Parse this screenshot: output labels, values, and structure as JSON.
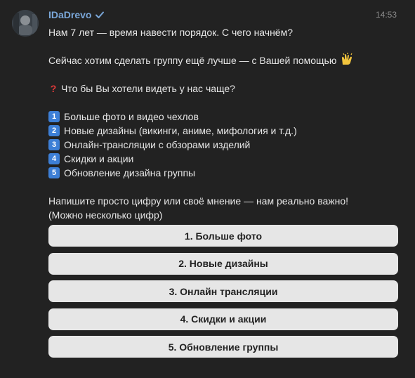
{
  "message": {
    "author": "IDaDrevo",
    "time": "14:53",
    "lines": {
      "l1": "Нам 7 лет — время навести порядок. С чего начнём?",
      "l2": "Сейчас хотим сделать группу ещё лучше — с Вашей помощью",
      "l3": "Что бы Вы хотели видеть у нас чаще?",
      "l4": "Напишите просто цифру или своё мнение — нам реально важно!",
      "l5": "(Можно несколько цифр)"
    },
    "options": [
      {
        "num": "1",
        "text": "Больше фото и видео чехлов"
      },
      {
        "num": "2",
        "text": "Новые дизайны (викинги, аниме, мифология и т.д.)"
      },
      {
        "num": "3",
        "text": "Онлайн-трансляции с обзорами изделий"
      },
      {
        "num": "4",
        "text": "Скидки и акции"
      },
      {
        "num": "5",
        "text": "Обновление дизайна группы"
      }
    ],
    "emoji_icons": {
      "hands": "raising-hands-icon",
      "question": "question-mark-icon"
    }
  },
  "keyboard": {
    "buttons": [
      "1. Больше фото",
      "2. Новые дизайны",
      "3. Онлайн трансляции",
      "4. Скидки и акции",
      "5. Обновление группы"
    ]
  },
  "colors": {
    "background": "#222222",
    "author": "#7aa7d9",
    "text": "#e6e6e6",
    "button_bg": "#e6e6e6",
    "number_icon": "#3d7fd6"
  }
}
